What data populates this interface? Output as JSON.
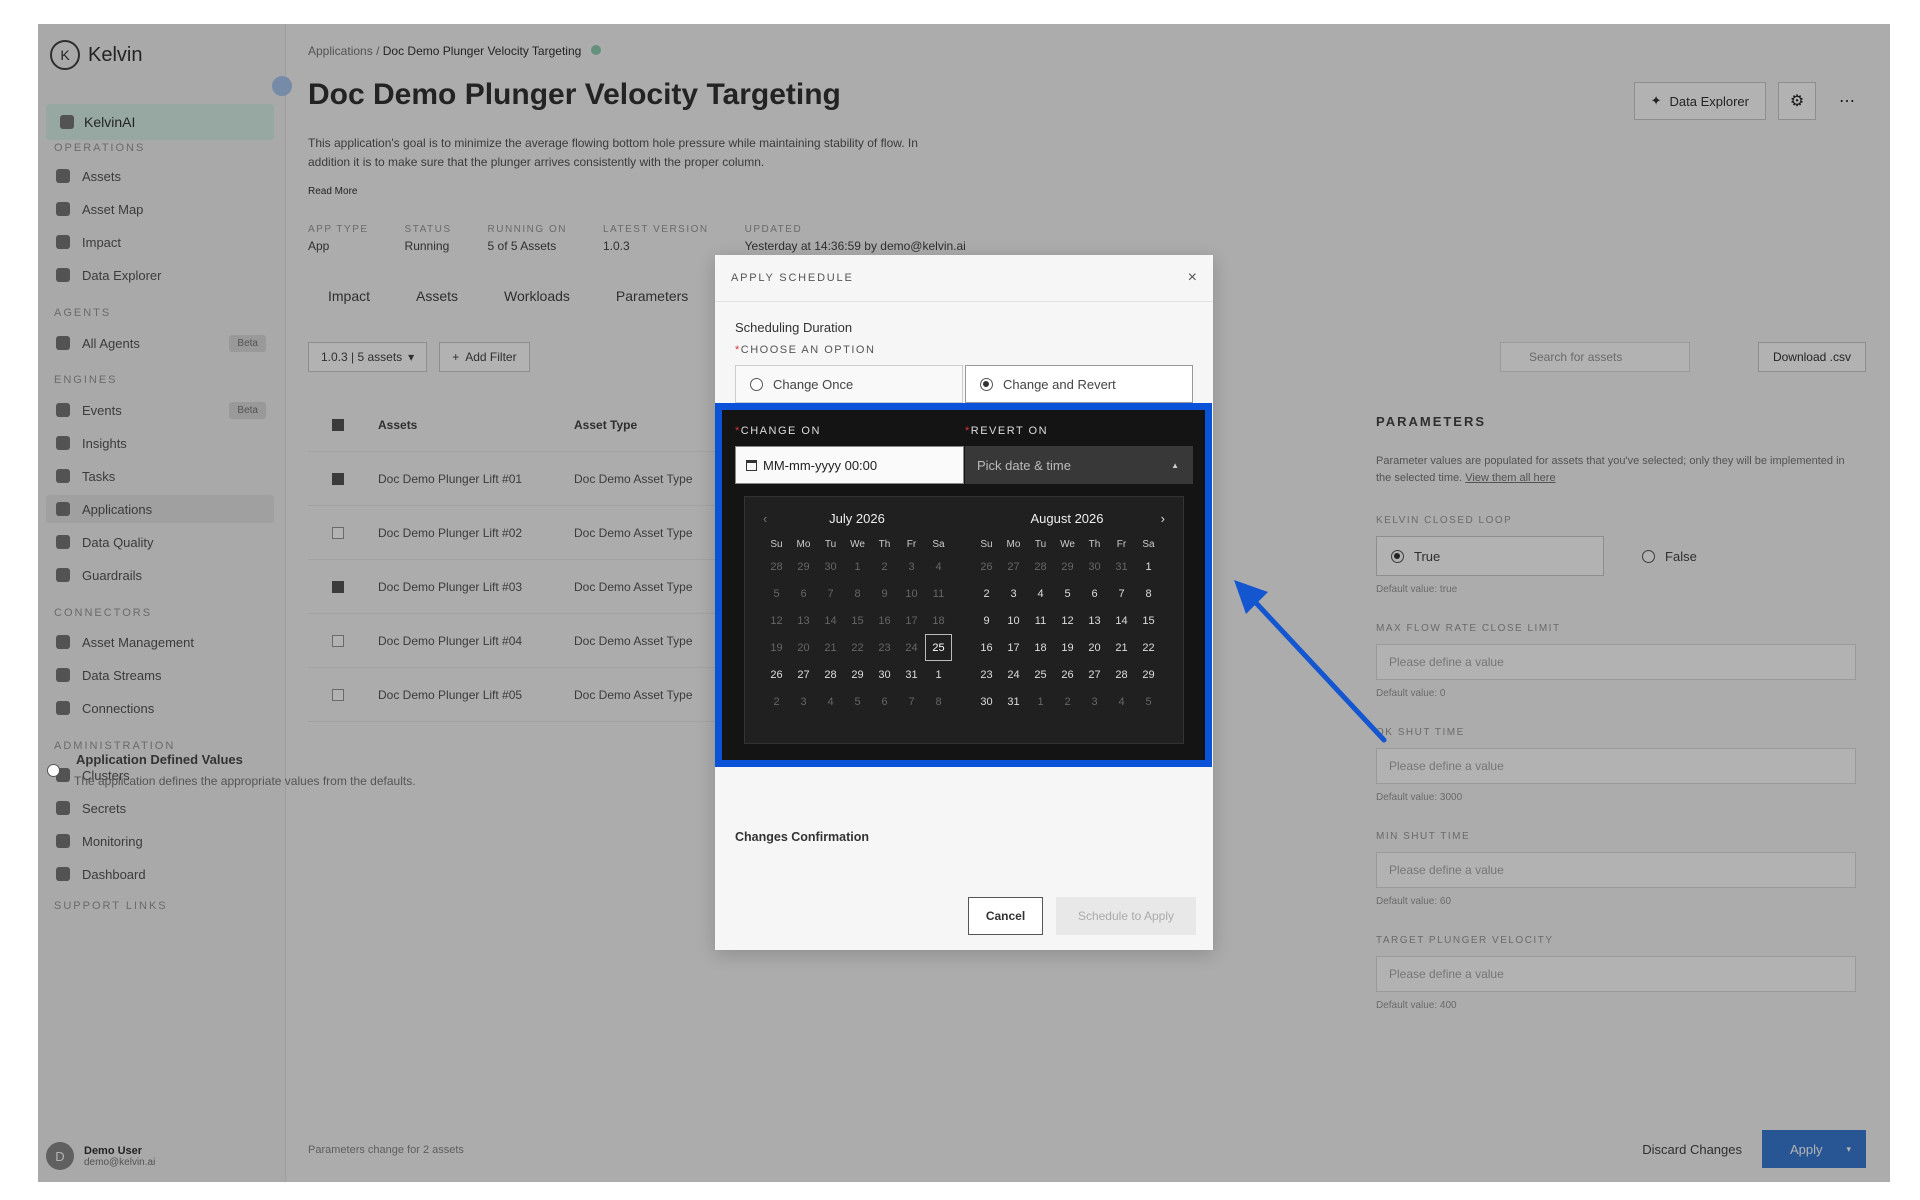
{
  "sidebar": {
    "brand": "Kelvin",
    "kelvinai": "KelvinAI",
    "sections": {
      "operations": "OPERATIONS",
      "agents": "AGENTS",
      "engines": "ENGINES",
      "connectors": "CONNECTORS",
      "administration": "ADMINISTRATION",
      "support": "SUPPORT LINKS"
    },
    "items": {
      "assets": "Assets",
      "asset_map": "Asset Map",
      "impact": "Impact",
      "data_explorer": "Data Explorer",
      "all_agents": "All Agents",
      "events": "Events",
      "insights": "Insights",
      "tasks": "Tasks",
      "applications": "Applications",
      "data_quality": "Data Quality",
      "guardrails": "Guardrails",
      "asset_management": "Asset Management",
      "data_streams": "Data Streams",
      "connections": "Connections",
      "clusters": "Clusters",
      "secrets": "Secrets",
      "monitoring": "Monitoring",
      "dashboard": "Dashboard"
    },
    "badges": {
      "agents": "Beta",
      "events": "Beta"
    },
    "user": {
      "initial": "D",
      "name": "Demo User",
      "email": "demo@kelvin.ai"
    }
  },
  "page": {
    "breadcrumb_root": "Applications",
    "breadcrumb_sep": "/",
    "breadcrumb_current": "Doc Demo Plunger Velocity Targeting",
    "title": "Doc Demo Plunger Velocity Targeting",
    "description": "This application's goal is to minimize the average flowing bottom hole pressure while maintaining stability of flow. In addition it is to make sure that the plunger arrives consistently with the proper column.",
    "read_more": "Read More",
    "meta": [
      {
        "label": "APP TYPE",
        "value": "App"
      },
      {
        "label": "STATUS",
        "value": "Running"
      },
      {
        "label": "RUNNING ON",
        "value": "5 of 5 Assets"
      },
      {
        "label": "LATEST VERSION",
        "value": "1.0.3"
      },
      {
        "label": "UPDATED",
        "value": "Yesterday at 14:36:59 by demo@kelvin.ai"
      }
    ],
    "data_explorer_btn": "Data Explorer",
    "tabs": [
      "Impact",
      "Assets",
      "Workloads",
      "Parameters"
    ],
    "version_chip": "1.0.3 | 5 assets",
    "add_filter": "Add Filter",
    "search_placeholder": "Search for assets",
    "download_csv": "Download .csv",
    "table": {
      "col_assets": "Assets",
      "col_type": "Asset Type",
      "rows": [
        {
          "name": "Doc Demo Plunger Lift #01",
          "type": "Doc Demo Asset Type"
        },
        {
          "name": "Doc Demo Plunger Lift #02",
          "type": "Doc Demo Asset Type"
        },
        {
          "name": "Doc Demo Plunger Lift #03",
          "type": "Doc Demo Asset Type"
        },
        {
          "name": "Doc Demo Plunger Lift #04",
          "type": "Doc Demo Asset Type"
        },
        {
          "name": "Doc Demo Plunger Lift #05",
          "type": "Doc Demo Asset Type"
        }
      ]
    },
    "params": {
      "title": "PARAMETERS",
      "note": "Parameter values are populated for assets that you've selected; only they will be implemented in the selected time.",
      "note_link": "View them all here",
      "closed_loop_label": "KELVIN CLOSED LOOP",
      "true_label": "True",
      "false_label": "False",
      "closed_loop_help": "Default value: true",
      "max_flow_label": "MAX FLOW RATE CLOSE LIMIT",
      "placeholder": "Please define a value",
      "max_flow_help": "Default value: 0",
      "ok_shutin_label": "OK SHUT TIME",
      "ok_shutin_help": "Default value: 3000",
      "min_shutin_label": "MIN SHUT TIME",
      "min_shutin_help": "Default value: 60",
      "target_label": "TARGET PLUNGER VELOCITY",
      "target_help": "Default value: 400"
    },
    "footer_note": "Parameters change for 2 assets",
    "discard": "Discard Changes",
    "apply": "Apply"
  },
  "modal": {
    "title": "APPLY SCHEDULE",
    "close": "×",
    "scheduling_duration": "Scheduling Duration",
    "choose_label": "CHOOSE AN OPTION",
    "option_once": "Change Once",
    "option_revert": "Change and Revert",
    "change_on_label": "CHANGE ON",
    "revert_on_label": "REVERT ON",
    "change_on_placeholder": "MM-mm-yyyy 00:00",
    "revert_on_placeholder": "Pick date & time",
    "appdef_title": "Application Defined Values",
    "appdef_desc": "The application defines the appropriate values from the defaults.",
    "changes_confirmation": "Changes Confirmation",
    "cancel": "Cancel",
    "schedule": "Schedule to Apply"
  },
  "calendar": {
    "prev": "‹",
    "next": "›",
    "dow": [
      "Su",
      "Mo",
      "Tu",
      "We",
      "Th",
      "Fr",
      "Sa"
    ],
    "months": [
      {
        "title": "July 2026",
        "days": [
          [
            "28",
            "29",
            "30",
            "1",
            "2",
            "3",
            "4"
          ],
          [
            "5",
            "6",
            "7",
            "8",
            "9",
            "10",
            "11"
          ],
          [
            "12",
            "13",
            "14",
            "15",
            "16",
            "17",
            "18"
          ],
          [
            "19",
            "20",
            "21",
            "22",
            "23",
            "24",
            "25"
          ],
          [
            "26",
            "27",
            "28",
            "29",
            "30",
            "31",
            "1"
          ],
          [
            "2",
            "3",
            "4",
            "5",
            "6",
            "7",
            "8"
          ]
        ],
        "enabled_from": 4,
        "enabled_to": 34,
        "selected": 27,
        "all_off_before": 27
      },
      {
        "title": "August 2026",
        "days": [
          [
            "26",
            "27",
            "28",
            "29",
            "30",
            "31",
            "1"
          ],
          [
            "2",
            "3",
            "4",
            "5",
            "6",
            "7",
            "8"
          ],
          [
            "9",
            "10",
            "11",
            "12",
            "13",
            "14",
            "15"
          ],
          [
            "16",
            "17",
            "18",
            "19",
            "20",
            "21",
            "22"
          ],
          [
            "23",
            "24",
            "25",
            "26",
            "27",
            "28",
            "29"
          ],
          [
            "30",
            "31",
            "1",
            "2",
            "3",
            "4",
            "5"
          ]
        ],
        "enabled_from": 6,
        "enabled_to": 36,
        "selected": -1
      }
    ]
  },
  "colors": {
    "highlight": "#0a52d8",
    "arrow": "#1356d0",
    "accent": "#3a7bd5"
  }
}
